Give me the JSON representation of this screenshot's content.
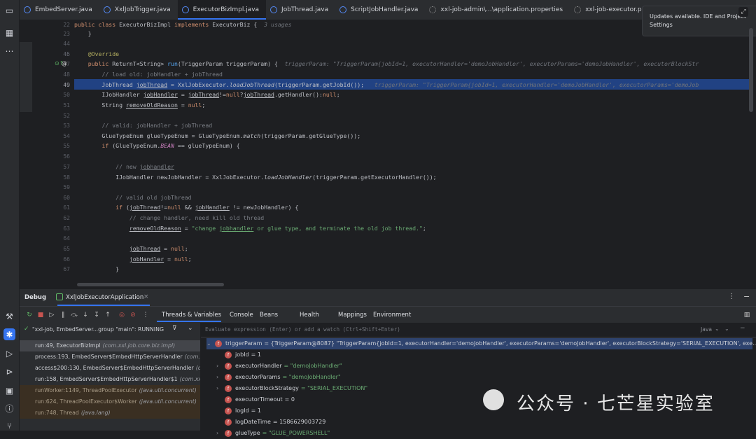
{
  "tabs": [
    {
      "label": "EmbedServer.java",
      "icon": "class-icon",
      "active": false
    },
    {
      "label": "XxlJobTrigger.java",
      "icon": "class-icon",
      "active": false
    },
    {
      "label": "ExecutorBizImpl.java",
      "icon": "class-icon",
      "active": true
    },
    {
      "label": "JobThread.java",
      "icon": "class-icon",
      "active": false
    },
    {
      "label": "ScriptJobHandler.java",
      "icon": "class-icon",
      "active": false
    },
    {
      "label": "xxl-job-admin\\...\\application.properties",
      "icon": "properties-icon",
      "active": false
    },
    {
      "label": "xxl-job-executor.prop",
      "icon": "properties-icon",
      "active": false
    }
  ],
  "notification": {
    "text": "Updates available. IDE and Project Settings"
  },
  "editor": {
    "line_numbers": [
      "22",
      "23",
      "44",
      "45",
      "46",
      "47",
      "48",
      "49",
      "50",
      "51",
      "52",
      "53",
      "54",
      "55",
      "56",
      "57",
      "58",
      "59",
      "60",
      "61",
      "62",
      "63",
      "64",
      "65",
      "66",
      "67"
    ],
    "header_line": "public class ExecutorBizImpl implements ExecutorBiz {",
    "header_hint": "3 usages",
    "current_line": "49"
  },
  "debug": {
    "title": "Debug",
    "session": "XxlJobExecutorApplication",
    "tabs": [
      "Threads & Variables",
      "Console",
      "Beans",
      "Health",
      "Mappings",
      "Environment"
    ],
    "thread_filter": "\"xxl-job, EmbedServer...group \"main\": RUNNING",
    "evaluate_placeholder": "Evaluate expression (Enter) or add a watch (Ctrl+Shift+Enter)",
    "lang": "Java",
    "frames": [
      {
        "method": "run:49, ExecutorBizImpl",
        "pkg": "(com.xxl.job.core.biz.impl)",
        "selected": true
      },
      {
        "method": "process:193, EmbedServer$EmbedHttpServerHandler",
        "pkg": "(com.xxl",
        "selected": false
      },
      {
        "method": "access$200:130, EmbedServer$EmbedHttpServerHandler",
        "pkg": "(co",
        "selected": false
      },
      {
        "method": "run:158, EmbedServer$EmbedHttpServerHandler$1",
        "pkg": "(com.xxl",
        "selected": false
      },
      {
        "method": "runWorker:1149, ThreadPoolExecutor",
        "pkg": "(java.util.concurrent)",
        "selected": false
      },
      {
        "method": "run:624, ThreadPoolExecutor$Worker",
        "pkg": "(java.util.concurrent)",
        "selected": false
      },
      {
        "method": "run:748, Thread",
        "pkg": "(java.lang)",
        "selected": false
      }
    ],
    "variables": [
      {
        "name": "triggerParam",
        "value": "= {TriggerParam@8087} \"TriggerParam{jobId=1, executorHandler='demoJobHandler', executorParams='demoJobHandler', executorBlockStrategy='SERIAL_EXECUTION', exe... View",
        "expand": "v",
        "level": 0
      },
      {
        "name": "jobId",
        "value": "= 1",
        "expand": "",
        "level": 1
      },
      {
        "name": "executorHandler",
        "value": "= \"demoJobHandler\"",
        "expand": ">",
        "level": 1
      },
      {
        "name": "executorParams",
        "value": "= \"demoJobHandler\"",
        "expand": ">",
        "level": 1
      },
      {
        "name": "executorBlockStrategy",
        "value": "= \"SERIAL_EXECUTION\"",
        "expand": ">",
        "level": 1
      },
      {
        "name": "executorTimeout",
        "value": "= 0",
        "expand": "",
        "level": 1
      },
      {
        "name": "logId",
        "value": "= 1",
        "expand": "",
        "level": 1
      },
      {
        "name": "logDateTime",
        "value": "= 1586629003729",
        "expand": "",
        "level": 1
      },
      {
        "name": "glueType",
        "value": "= \"GLUE_POWERSHELL\"",
        "expand": ">",
        "level": 1
      }
    ]
  },
  "watermark": "公众号 · 七芒星实验室"
}
